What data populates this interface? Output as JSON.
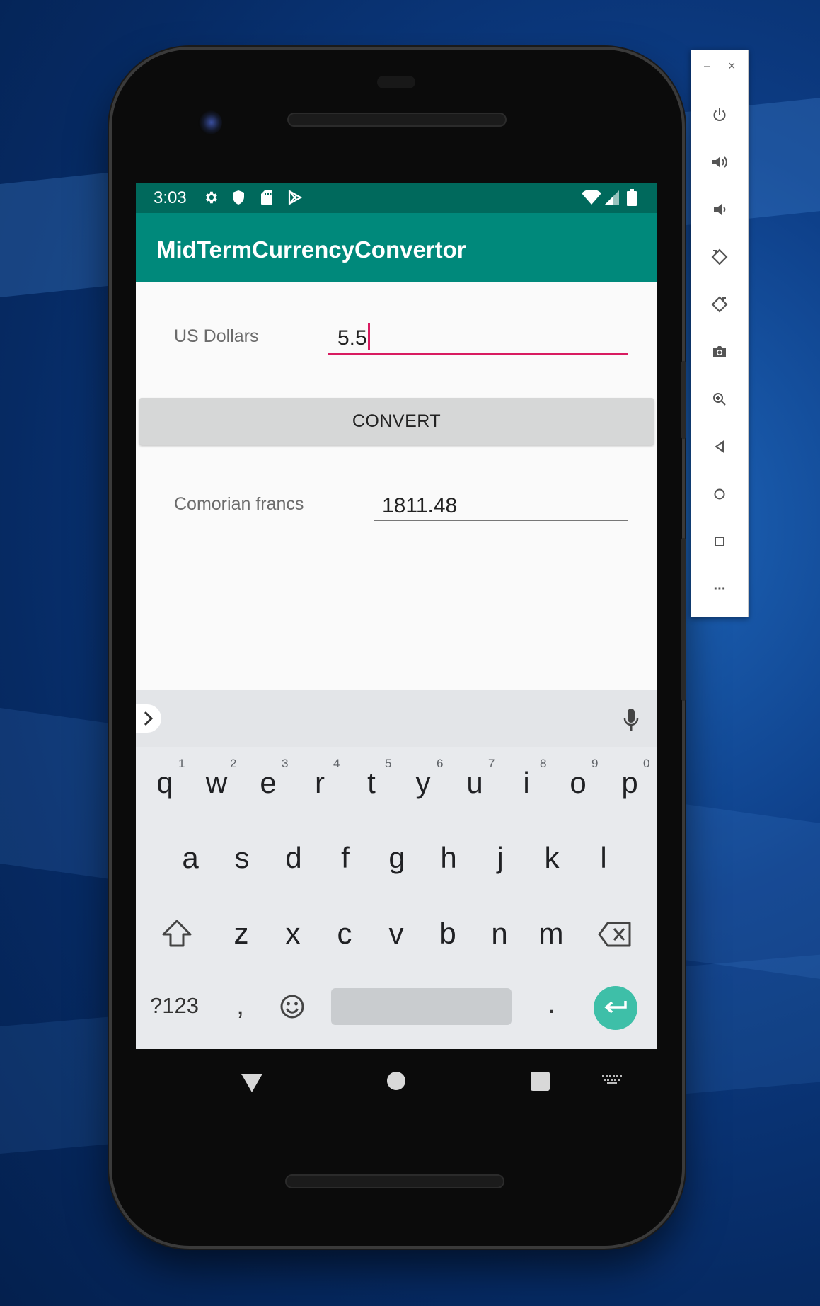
{
  "status_bar": {
    "time": "3:03",
    "icons": [
      "settings-icon",
      "shield-icon",
      "sd-card-icon",
      "play-store-icon",
      "wifi-icon",
      "signal-icon",
      "battery-icon"
    ]
  },
  "app": {
    "title": "MidTermCurrencyConvertor",
    "colors": {
      "status_bar": "#00695c",
      "app_bar": "#00897b",
      "accent": "#d81b60"
    }
  },
  "form": {
    "usd_label": "US Dollars",
    "usd_value": "5.5",
    "convert_label": "CONVERT",
    "result_label": "Comorian francs",
    "result_value": "1811.48"
  },
  "keyboard": {
    "row1": [
      "q",
      "w",
      "e",
      "r",
      "t",
      "y",
      "u",
      "i",
      "o",
      "p"
    ],
    "row1_hints": [
      "1",
      "2",
      "3",
      "4",
      "5",
      "6",
      "7",
      "8",
      "9",
      "0"
    ],
    "row2": [
      "a",
      "s",
      "d",
      "f",
      "g",
      "h",
      "j",
      "k",
      "l"
    ],
    "row3": [
      "z",
      "x",
      "c",
      "v",
      "b",
      "n",
      "m"
    ],
    "symbols_label": "?123",
    "comma": ",",
    "period": "."
  },
  "emulator_panel": {
    "minimize": "–",
    "close": "×",
    "tools": [
      "power-icon",
      "volume-up-icon",
      "volume-down-icon",
      "rotate-left-icon",
      "rotate-right-icon",
      "camera-icon",
      "zoom-icon",
      "back-icon",
      "home-icon",
      "overview-icon",
      "more-icon"
    ],
    "more_label": "···"
  }
}
